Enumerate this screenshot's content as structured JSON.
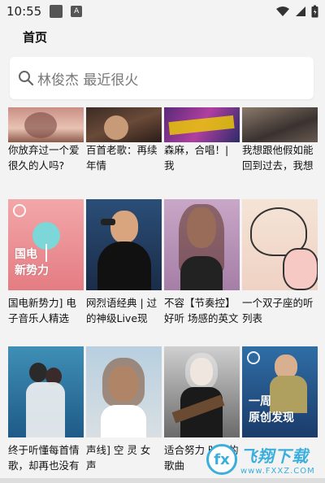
{
  "status_bar": {
    "time": "10:55",
    "notif_letter": "A"
  },
  "app_bar": {
    "title": "首页"
  },
  "search": {
    "placeholder": "林俊杰 最近很火"
  },
  "rows": [
    {
      "tiles": [
        {
          "caption": "你放弃过一个爱很久的人吗?"
        },
        {
          "caption": "百首老歌：再续年情"
        },
        {
          "caption": "森麻，合唱！| 我"
        },
        {
          "caption": "我想跟他假如能回到过去，我想和你想做什么"
        }
      ]
    },
    {
      "tiles": [
        {
          "caption": "国电新势力] 电子音乐人精选",
          "overlay": "国电\n新势力"
        },
        {
          "caption": "网烈语经典 | 过的神级Live现"
        },
        {
          "caption": "不容【节奏控】好听 场感的英文歌"
        },
        {
          "caption": "一个双子座的听 列表"
        }
      ]
    },
    {
      "tiles": [
        {
          "caption": "终于听懂每首情歌，却再也没有"
        },
        {
          "caption": "声线] 空 灵 女 声"
        },
        {
          "caption": "适合努力 时听的歌曲"
        },
        {
          "caption": "",
          "overlay": "一周\n原创发现"
        }
      ]
    }
  ],
  "watermark": {
    "big": "飞翔下载",
    "small": "www.FXXZ.COM"
  },
  "colors": {
    "accent": "#3aaedc"
  }
}
